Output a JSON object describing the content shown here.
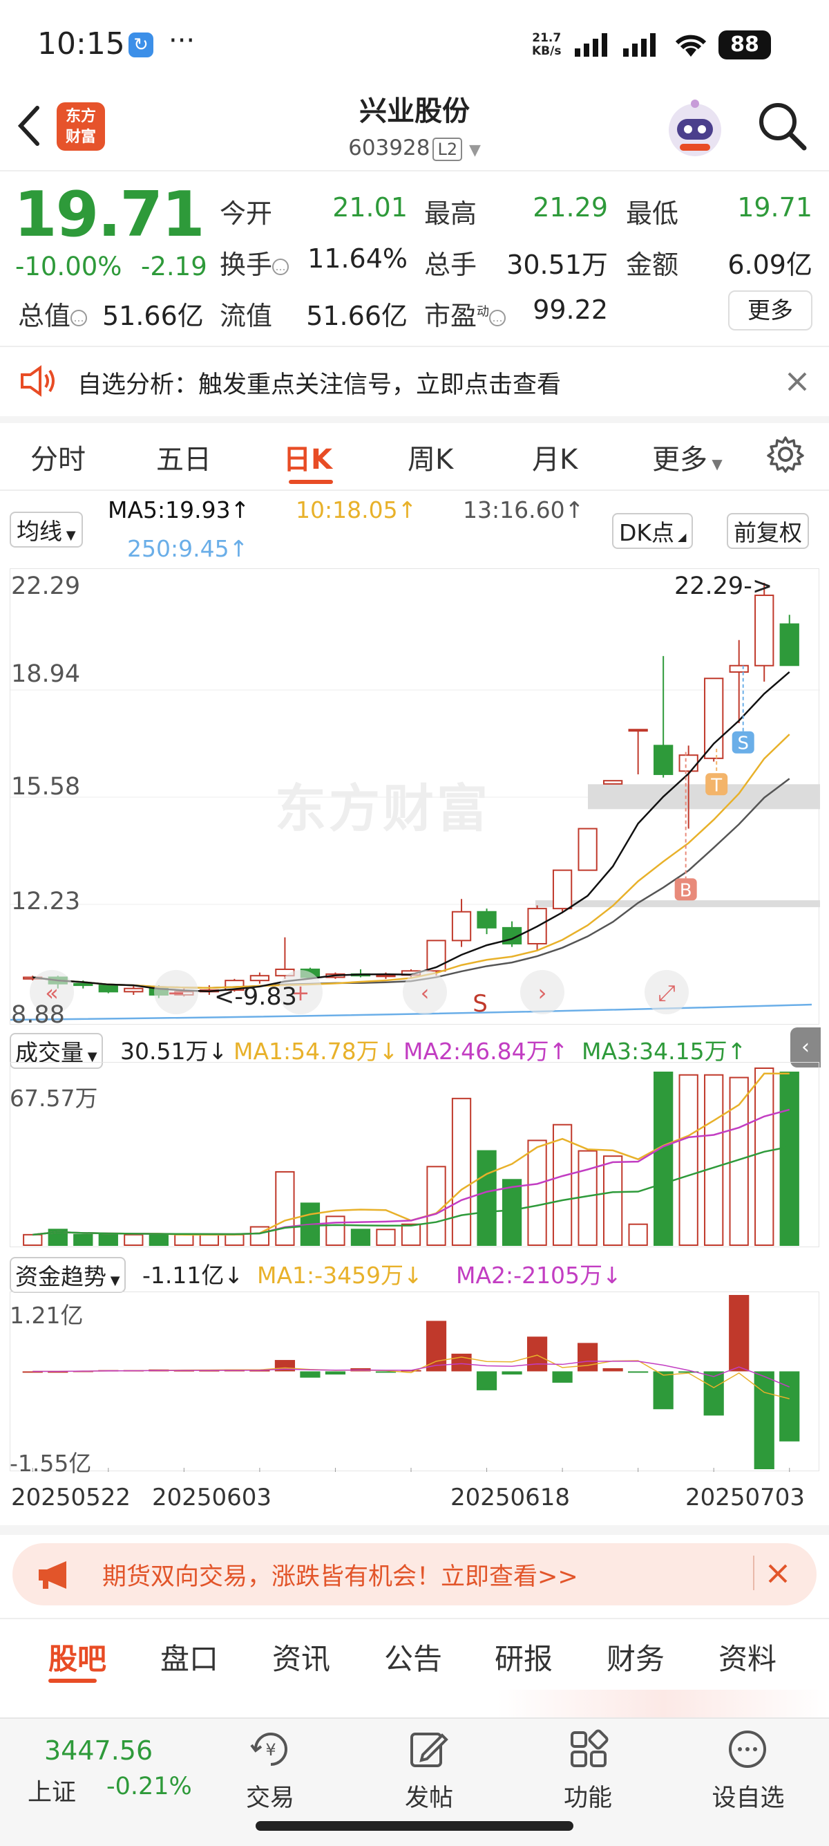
{
  "status": {
    "time": "10:15",
    "dots": "···",
    "speed_top": "21.7",
    "speed_unit": "KB/s",
    "battery": "88"
  },
  "header": {
    "logo_line1": "东方",
    "logo_line2": "财富",
    "title": "兴业股份",
    "code": "603928",
    "level": "L2"
  },
  "quote": {
    "price": "19.71",
    "pct": "-10.00%",
    "change": "-2.19",
    "rows": [
      [
        {
          "l": "今开",
          "v": "21.01"
        },
        {
          "l": "最高",
          "v": "21.29"
        },
        {
          "l": "最低",
          "v": "19.71"
        }
      ],
      [
        {
          "l": "换手",
          "v": "11.64%"
        },
        {
          "l": "总手",
          "v": "30.51万"
        },
        {
          "l": "金额",
          "v": "6.09亿"
        }
      ]
    ],
    "zongzhi_label": "总值",
    "zongzhi": "51.66亿",
    "liuzhi_label": "流值",
    "liuzhi": "51.66亿",
    "shiying_label": "市盈",
    "shiying_sup": "动",
    "shiying": "99.22",
    "more": "更多"
  },
  "notice": {
    "text": "自选分析：触发重点关注信号，立即点击查看"
  },
  "tabs": [
    "分时",
    "五日",
    "日K",
    "周K",
    "月K",
    "更多"
  ],
  "indicators": {
    "selector": "均线",
    "ma5": "MA5:19.93↑",
    "ma10": "10:18.05↑",
    "ma13": "13:16.60↑",
    "ma250": "250:9.45↑",
    "dk": "DK点",
    "fq": "前复权"
  },
  "colors": {
    "up": "#c0392b",
    "down": "#2e9a3a",
    "accent": "#e84c25",
    "ma5": "#111111",
    "ma10": "#e8b12a",
    "ma13": "#555555",
    "ma250": "#6aaee8"
  },
  "chart_data": [
    {
      "type": "candlestick",
      "title": "日K",
      "ylim": [
        8.88,
        22.29
      ],
      "y_ticks": [
        "22.29",
        "18.94",
        "15.58",
        "12.23",
        "8.88"
      ],
      "annotations": {
        "high": "22.29->",
        "low": "<-9.83",
        "markers": [
          "B",
          "T",
          "S",
          "S"
        ]
      },
      "ohlc": [
        [
          9.9,
          10.0,
          9.85,
          9.95
        ],
        [
          9.95,
          10.0,
          9.6,
          9.75
        ],
        [
          9.75,
          9.85,
          9.6,
          9.7
        ],
        [
          9.7,
          9.75,
          9.45,
          9.5
        ],
        [
          9.5,
          9.7,
          9.4,
          9.6
        ],
        [
          9.6,
          9.7,
          9.3,
          9.4
        ],
        [
          9.4,
          9.6,
          9.35,
          9.5
        ],
        [
          9.5,
          9.7,
          9.4,
          9.55
        ],
        [
          9.55,
          9.9,
          9.5,
          9.85
        ],
        [
          9.85,
          10.1,
          9.75,
          10.0
        ],
        [
          10.0,
          11.2,
          9.9,
          10.2
        ],
        [
          10.2,
          10.25,
          9.9,
          9.95
        ],
        [
          9.95,
          10.1,
          9.9,
          10.05
        ],
        [
          10.05,
          10.2,
          9.95,
          10.0
        ],
        [
          10.0,
          10.1,
          9.9,
          10.02
        ],
        [
          10.02,
          10.2,
          9.95,
          10.15
        ],
        [
          10.15,
          11.1,
          10.0,
          11.1
        ],
        [
          11.1,
          12.4,
          10.9,
          12.0
        ],
        [
          12.0,
          12.1,
          11.3,
          11.5
        ],
        [
          11.5,
          11.7,
          10.9,
          11.0
        ],
        [
          11.0,
          12.2,
          10.8,
          12.1
        ],
        [
          12.1,
          13.3,
          12.0,
          13.3
        ],
        [
          13.3,
          14.6,
          13.3,
          14.6
        ],
        [
          16.0,
          16.1,
          16.0,
          16.1
        ],
        [
          17.7,
          17.7,
          16.3,
          17.7
        ],
        [
          17.2,
          20.0,
          16.2,
          16.3
        ],
        [
          16.4,
          17.2,
          14.6,
          16.9
        ],
        [
          16.8,
          19.3,
          16.7,
          19.3
        ],
        [
          19.5,
          20.5,
          17.9,
          19.7
        ],
        [
          19.7,
          22.29,
          19.2,
          21.9
        ],
        [
          21.0,
          21.29,
          19.71,
          19.71
        ]
      ]
    },
    {
      "type": "bar",
      "title": "成交量",
      "label": "成交量",
      "current": "30.51万↓",
      "ma1": "MA1:54.78万↓",
      "ma2": "MA2:46.84万↑",
      "ma3": "MA3:34.15万↑",
      "ymax_label": "67.57万",
      "ylim": [
        0,
        67.57
      ],
      "values": [
        4,
        6,
        4,
        4,
        4,
        4,
        4,
        4,
        4,
        7,
        28,
        16,
        11,
        6,
        6,
        8,
        30,
        56,
        36,
        25,
        40,
        46,
        36,
        34,
        8,
        66,
        65,
        65,
        64,
        67.57,
        66
      ]
    },
    {
      "type": "bar",
      "title": "资金趋势",
      "label": "资金趋势",
      "current": "-1.11亿↓",
      "ma1": "MA1:-3459万↓",
      "ma2": "MA2:-2105万↓",
      "ylim": [
        -1.55,
        1.21
      ],
      "y_ticks": [
        "1.21亿",
        "-1.55亿"
      ],
      "values": [
        0,
        0,
        0.01,
        0.02,
        0.02,
        0.03,
        0.02,
        0.02,
        0.03,
        0.02,
        0.18,
        -0.1,
        -0.05,
        0.05,
        -0.02,
        0.02,
        0.8,
        0.28,
        -0.3,
        -0.05,
        0.55,
        -0.18,
        0.45,
        0.05,
        -0.02,
        -0.6,
        -0.02,
        -0.7,
        1.21,
        -1.55,
        -1.11
      ],
      "x_ticks": [
        "20250522",
        "20250603",
        "20250618",
        "20250703"
      ]
    }
  ],
  "promo": {
    "text": "期货双向交易，涨跌皆有机会！立即查看>>"
  },
  "bottom_tabs": [
    "股吧",
    "盘口",
    "资讯",
    "公告",
    "研报",
    "财务",
    "资料"
  ],
  "bottom_bar": {
    "index_value": "3447.56",
    "index_name": "上证",
    "index_change": "-0.21%",
    "trade": "交易",
    "post": "发帖",
    "function": "功能",
    "watch": "设自选"
  }
}
